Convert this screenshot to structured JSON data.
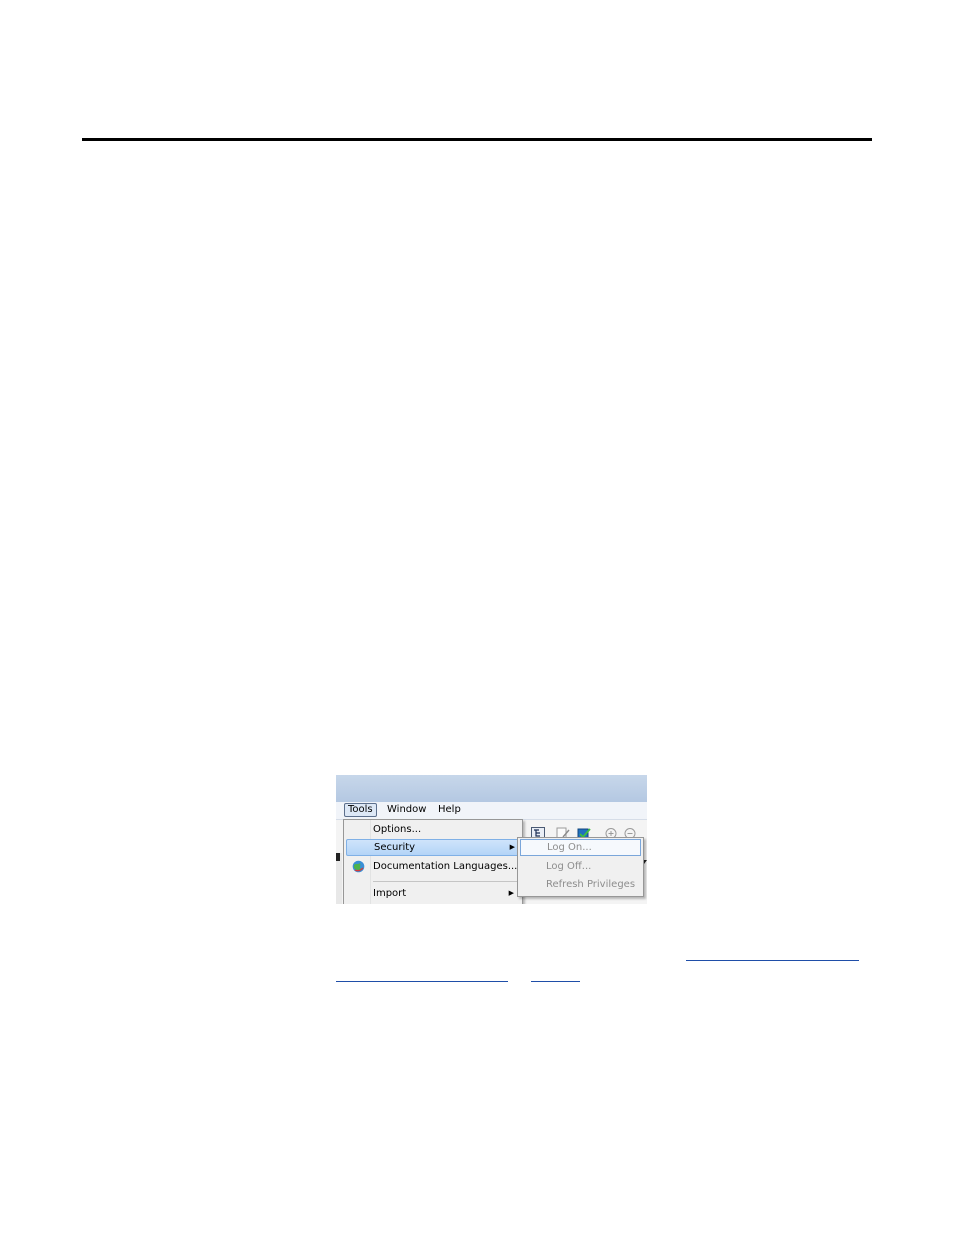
{
  "menubar": {
    "items": [
      "Tools",
      "Window",
      "Help"
    ]
  },
  "tools_menu": {
    "items": [
      {
        "label": "Options...",
        "has_submenu": false
      },
      {
        "label": "Security",
        "has_submenu": true,
        "highlighted": true
      },
      {
        "label": "Documentation Languages...",
        "has_submenu": false,
        "icon": "globe-icon"
      },
      {
        "label": "Import",
        "has_submenu": true
      }
    ]
  },
  "security_submenu": {
    "items": [
      {
        "label": "Log On...",
        "enabled": false
      },
      {
        "label": "Log Off...",
        "enabled": false
      },
      {
        "label": "Refresh Privileges",
        "enabled": false
      }
    ]
  },
  "colors": {
    "highlight": "#b3d4f7",
    "disabled_text": "#8d8d8d",
    "link": "#1f4ea8"
  }
}
